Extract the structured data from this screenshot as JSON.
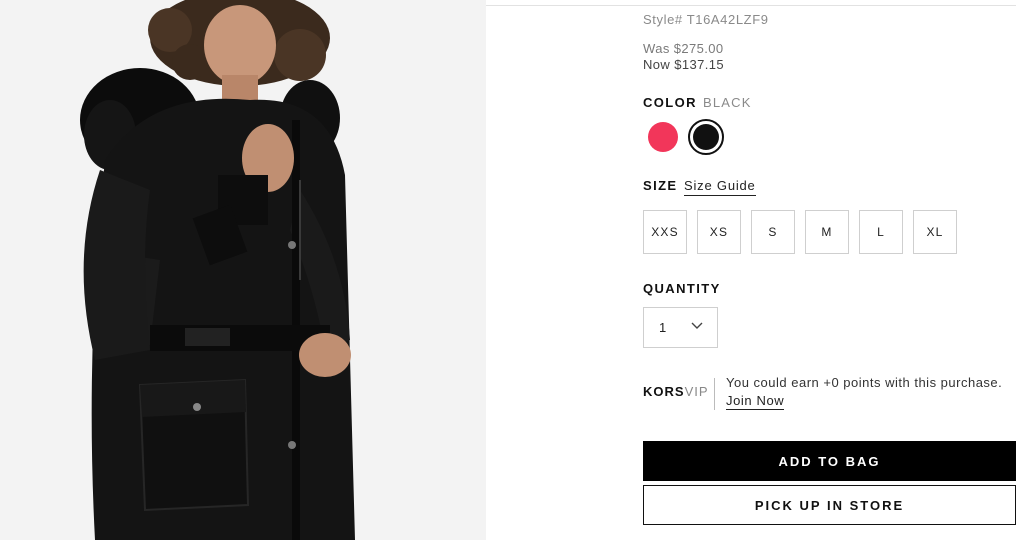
{
  "product": {
    "style": "Style# T16A42LZF9",
    "price_was": "Was $275.00",
    "price_now": "Now $137.15"
  },
  "color": {
    "label": "COLOR",
    "selected": "BLACK",
    "swatches": [
      {
        "name": "red",
        "hex": "#f2365a"
      },
      {
        "name": "black",
        "hex": "#111111"
      }
    ]
  },
  "size": {
    "label": "SIZE",
    "guide": "Size Guide",
    "options": [
      "XXS",
      "XS",
      "S",
      "M",
      "L",
      "XL"
    ]
  },
  "quantity": {
    "label": "QUANTITY",
    "value": "1"
  },
  "vip": {
    "brand_bold": "KORS",
    "brand_light": "VIP",
    "message": "You could earn +0 points with this purchase.",
    "join": "Join Now"
  },
  "actions": {
    "add_to_bag": "ADD TO BAG",
    "pick_up": "PICK UP IN STORE"
  }
}
